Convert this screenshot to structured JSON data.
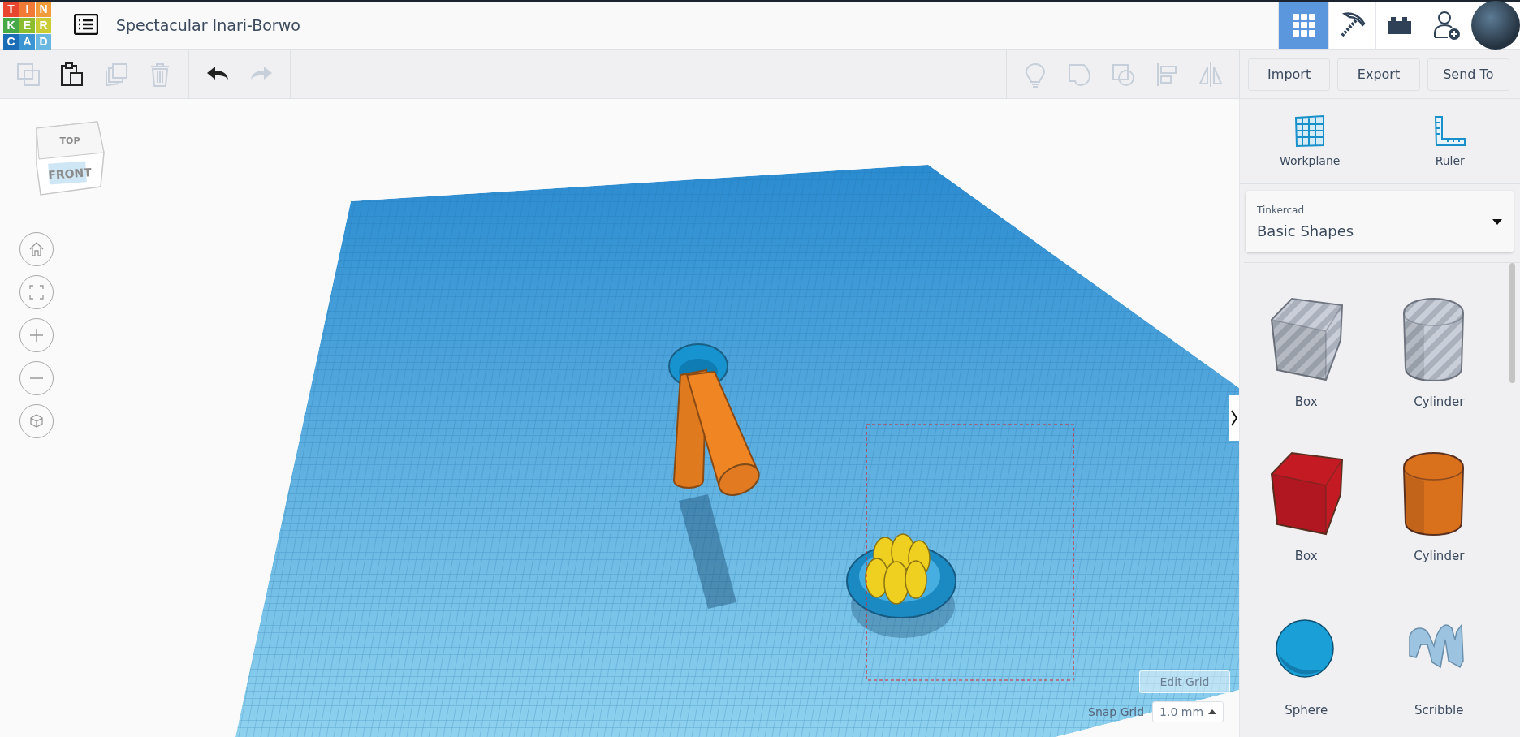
{
  "logo": {
    "tiles": [
      {
        "letter": "T",
        "color": "#e8462f"
      },
      {
        "letter": "I",
        "color": "#f17a36"
      },
      {
        "letter": "N",
        "color": "#f29b3b"
      },
      {
        "letter": "K",
        "color": "#47a848"
      },
      {
        "letter": "E",
        "color": "#8cbd2e"
      },
      {
        "letter": "R",
        "color": "#c9cc34"
      },
      {
        "letter": "C",
        "color": "#1a6cb5"
      },
      {
        "letter": "A",
        "color": "#3b95d2"
      },
      {
        "letter": "D",
        "color": "#6ab8e2"
      }
    ]
  },
  "title": "Spectacular Inari-Borwo",
  "header_tools": [
    {
      "kind": "grid",
      "selected": true
    },
    {
      "kind": "pickaxe",
      "selected": false
    },
    {
      "kind": "bricks",
      "selected": false
    },
    {
      "kind": "add-user",
      "selected": false
    },
    {
      "kind": "avatar",
      "selected": false
    }
  ],
  "toolbar": {
    "edit_tools": [
      {
        "kind": "copy",
        "disabled": true
      },
      {
        "kind": "paste",
        "disabled": false
      },
      {
        "kind": "duplicate",
        "disabled": true
      },
      {
        "kind": "delete",
        "disabled": true
      }
    ],
    "history_tools": [
      {
        "kind": "undo",
        "disabled": false
      },
      {
        "kind": "redo",
        "disabled": true
      }
    ],
    "shape_tools": [
      {
        "kind": "notes",
        "disabled": true
      },
      {
        "kind": "group",
        "disabled": true
      },
      {
        "kind": "ungroup",
        "disabled": true
      },
      {
        "kind": "align",
        "disabled": true
      },
      {
        "kind": "mirror",
        "disabled": true
      }
    ],
    "buttons": [
      "Import",
      "Export",
      "Send To"
    ]
  },
  "view_cube": {
    "top": "TOP",
    "front": "FRONT"
  },
  "view_controls": [
    {
      "kind": "home"
    },
    {
      "kind": "fit"
    },
    {
      "kind": "zoom-in"
    },
    {
      "kind": "zoom-out"
    },
    {
      "kind": "perspective"
    }
  ],
  "canvas": {
    "edit_grid_button": "Edit Grid",
    "snap_grid": {
      "label": "Snap Grid",
      "value": "1.0 mm"
    }
  },
  "sidebar": {
    "tools": [
      {
        "kind": "workplane",
        "label": "Workplane"
      },
      {
        "kind": "ruler",
        "label": "Ruler"
      }
    ],
    "library": {
      "source": "Tinkercad",
      "value": "Basic Shapes"
    },
    "shapes": [
      {
        "kind": "box",
        "label": "Box",
        "hole": true
      },
      {
        "kind": "cylinder",
        "label": "Cylinder",
        "hole": true
      },
      {
        "kind": "box",
        "label": "Box",
        "hole": false,
        "color": "#c41a24"
      },
      {
        "kind": "cylinder",
        "label": "Cylinder",
        "hole": false,
        "color": "#d9701c"
      },
      {
        "kind": "sphere",
        "label": "Sphere",
        "hole": false,
        "color": "#1a9fd6"
      },
      {
        "kind": "scribble",
        "label": "Scribble",
        "hole": false,
        "color": "#9cc3e0"
      }
    ]
  }
}
